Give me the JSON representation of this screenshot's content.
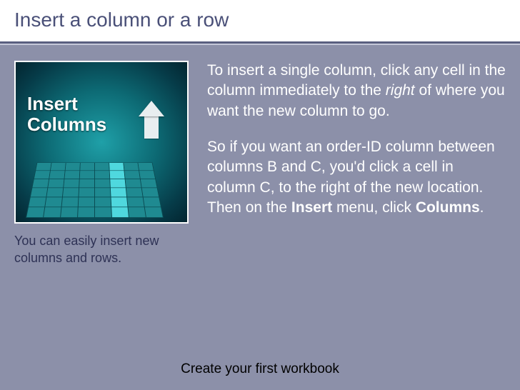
{
  "title": "Insert a column or a row",
  "image": {
    "label_line1": "Insert",
    "label_line2": "Columns"
  },
  "caption": "You can easily insert new columns and rows.",
  "paragraphs": {
    "p1_a": "To insert a single column, click any cell in the column immediately to the ",
    "p1_italic": "right",
    "p1_b": " of where you want the new column to go.",
    "p2_a": "So if you want an order-ID column between columns B and C, you'd click a cell in column C, to the right of the new location. Then on the ",
    "p2_bold1": "Insert",
    "p2_b": " menu, click ",
    "p2_bold2": "Columns",
    "p2_c": "."
  },
  "footer": "Create your first workbook"
}
